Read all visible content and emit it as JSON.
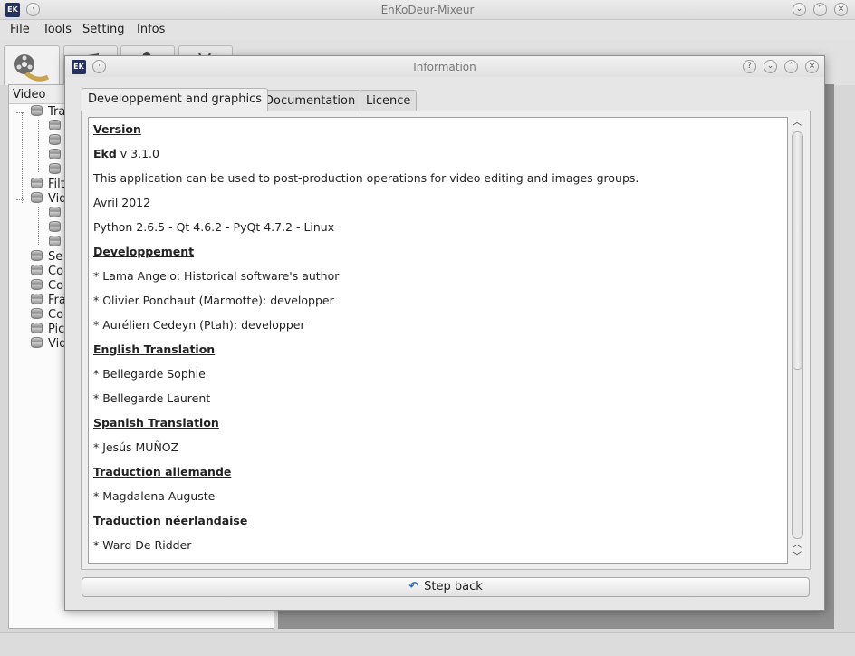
{
  "main_window": {
    "title": "EnKoDeur-Mixeur",
    "menu": [
      "File",
      "Tools",
      "Setting",
      "Infos"
    ],
    "left_panel": {
      "header": "Video",
      "tree": [
        {
          "label": "Tra"
        },
        {
          "label": ""
        },
        {
          "label": ""
        },
        {
          "label": ""
        },
        {
          "label": ""
        },
        {
          "label": "Filt"
        },
        {
          "label": "Vid"
        },
        {
          "label": ""
        },
        {
          "label": ""
        },
        {
          "label": ""
        },
        {
          "label": "Se"
        },
        {
          "label": "Co"
        },
        {
          "label": "Co"
        },
        {
          "label": "Fra"
        },
        {
          "label": "Co"
        },
        {
          "label": "Pic"
        },
        {
          "label": "Vid"
        }
      ]
    }
  },
  "dialog": {
    "title": "Information",
    "tabs": [
      "Developpement and graphics",
      "Documentation",
      "Licence"
    ],
    "active_tab": 0,
    "content": {
      "version_heading": "Version",
      "version_name": "Ekd",
      "version_number": "v 3.1.0",
      "description": "This application can be used to post-production operations for video editing and images groups.",
      "date": "Avril 2012",
      "platform": "Python 2.6.5 - Qt 4.6.2 - PyQt 4.7.2 - Linux",
      "dev_heading": "Developpement",
      "dev_1": "* Lama Angelo: Historical software's author",
      "dev_2": "* Olivier Ponchaut (Marmotte): developper",
      "dev_3": "* Aurélien Cedeyn (Ptah): developper",
      "en_heading": "English Translation",
      "en_1": "* Bellegarde Sophie",
      "en_2": "* Bellegarde Laurent",
      "es_heading": "Spanish Translation",
      "es_1": "* Jesús MUÑOZ",
      "de_heading": "Traduction allemande",
      "de_1": "* Magdalena Auguste",
      "nl_heading": "Traduction néerlandaise",
      "nl_1": "* Ward De Ridder"
    },
    "step_back_label": "Step back"
  }
}
